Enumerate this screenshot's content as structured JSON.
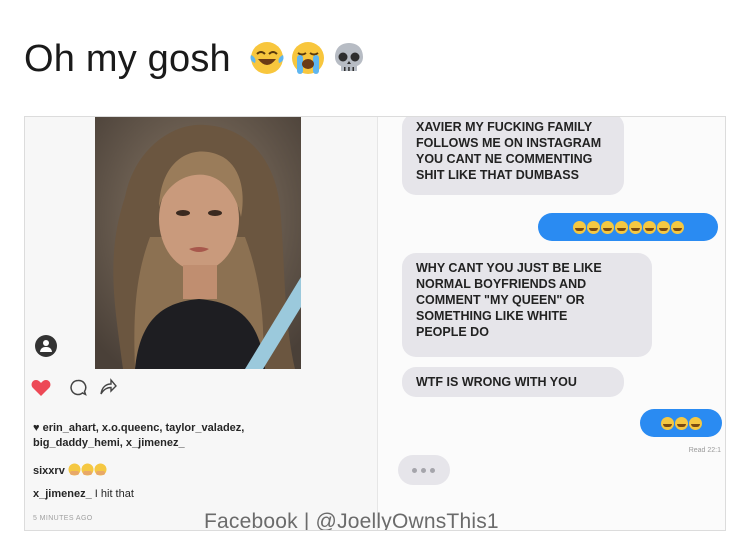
{
  "post": {
    "caption": "Oh my gosh",
    "emojis": [
      "laughing-tears-emoji",
      "crying-emoji",
      "skull-emoji"
    ]
  },
  "instagram": {
    "likers_line1": "erin_ahart, x.o.queenc, taylor_valadez,",
    "likers_line2": "big_daddy_hemi, x_jimenez_",
    "comment1_user": "sixxrv",
    "comment2_user": "x_jimenez_",
    "comment2_text": "I hit that",
    "timestamp": "5 MINUTES AGO"
  },
  "messages": {
    "received1": [
      "XAVIER MY FUCKING FAMILY",
      "FOLLOWS ME ON INSTAGRAM",
      "YOU CANT NE COMMENTING",
      "SHIT LIKE THAT DUMBASS"
    ],
    "sent1_emoji_count": 8,
    "received2": [
      "WHY CANT YOU JUST BE LIKE",
      "NORMAL BOYFRIENDS AND",
      "COMMENT \"MY QUEEN\" OR",
      "SOMETHING LIKE WHITE",
      "PEOPLE DO"
    ],
    "received3": "WTF IS WRONG WITH YOU",
    "sent2_emoji_count": 3,
    "read_receipt": "Read 22:1"
  },
  "watermark": "Facebook | @JoellyOwnsThis1",
  "colors": {
    "sent_bubble": "#2a8bf2",
    "received_bubble": "#e6e5ea",
    "heart": "#ed4956"
  }
}
